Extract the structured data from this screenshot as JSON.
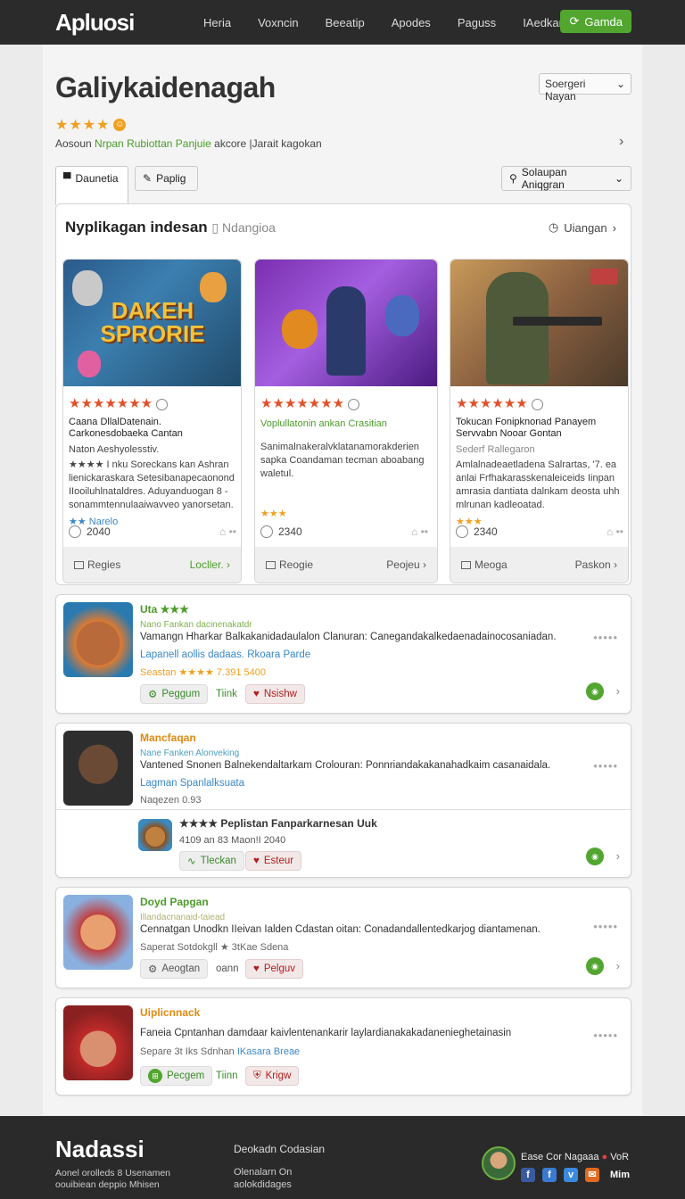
{
  "header": {
    "logo": "Apluosi",
    "nav": [
      "Heria",
      "Voxncin",
      "Beeatip",
      "Apodes",
      "Paguss",
      "IAedkamols"
    ],
    "cta": "Gamda"
  },
  "page": {
    "title": "Galiykaidenagah",
    "sort_label": "Soergeri Nayan",
    "rating_stars": "★★★★",
    "subtitle_prefix": "Aosoun",
    "subtitle_highlight": "Nrpan Rubiottan Panjuie",
    "subtitle_suffix": "akcore |Jarait kagokan",
    "tabs": [
      {
        "label": "Daunetia",
        "icon": "folder-icon"
      },
      {
        "label": "Paplig",
        "icon": "pencil-icon"
      }
    ],
    "filter_label": "Solaupan Aniqgran"
  },
  "featured": {
    "heading": "Nyplikagan indesan",
    "heading_muted": "Ndangioa",
    "action": "Uiangan",
    "cards": [
      {
        "banner_text": "DAKEH SPRORIE",
        "rating": "★★★★★★★",
        "title": "Caana DllalDatenain. Carkonesdobaeka Cantan",
        "subtitle": "Naton Aeshyolesstiv.",
        "description": "★★★★ I nku Soreckans kan Ashran lienickaraskara Setesibanapecaonond IIooiluhlnataldres. Aduyanduogan 8 - sonammtennulaaiwavveo yanorsetan.",
        "link": "★★ Narelo",
        "count": "2040",
        "footer_left": "Regies",
        "footer_right": "Locller."
      },
      {
        "banner_text": "",
        "rating": "★★★★★★★",
        "title": "Voplullatonin ankan Crasitian",
        "subtitle": "",
        "description": "Sanimalnakeralvklatanamorakderien sapka Coandaman tecman aboabang waletul.",
        "link": "★★★",
        "count": "2340",
        "footer_left": "Reogie",
        "footer_right": "Peojeu"
      },
      {
        "banner_text": "",
        "rating": "★★★★★★",
        "title": "Tokucan Fonipknonad Panayem Servvabn Nooar Gontan",
        "subtitle": "Sederf Rallegaron",
        "description": "Amlalnadeaetladena Salrartas, '7. ea anlai Frfhakarasskenaleiceids Iinpan amrasia dantiata dalnkam deosta uhh mlrunan kadleoatad.",
        "link": "★★★",
        "count": "2340",
        "footer_left": "Meoga",
        "footer_right": "Paskon"
      }
    ]
  },
  "list": [
    {
      "name": "Uta ★★★",
      "sub": "Nano Fankan dacinenakatdr",
      "description": "Vamangn Hharkar Balkakanidadaulalon Clanuran: Canegandakalkedaenadainocosaniadan.",
      "link": "Lapanell aollis dadaas. Rkoara Parde",
      "meta": "Seastan ★★★★ 7.391 5400",
      "pills": [
        "Peggum",
        "Tiink",
        "Nsishw"
      ]
    },
    {
      "name": "Mancfaqan",
      "sub": "Nane Fanken Alonveking",
      "description": "Vantened Snonen Balnekendaltarkam Crolouran: Ponnriandakakanahadkaim casanaidala.",
      "link": "Lagman Spanlalksuata",
      "meta": "Naqezen 0.93",
      "nested": {
        "title": "★★★★ Peplistan Fanparkarnesan Uuk",
        "meta": "4109 an 83 Maon!I 2040",
        "pills": [
          "Tleckan",
          "Esteur"
        ]
      }
    },
    {
      "name": "Doyd Papgan",
      "sub": "Illandacnanaid-taiead",
      "description": "Cennatgan Unodkn IIeivan Ialden Cdastan oitan: Conadandallentedkarjog diantamenan.",
      "link": "",
      "meta": "Saperat Sotdokgll ★ 3tKae Sdena",
      "pills": [
        "Aeogtan",
        "oann",
        "Pelguv"
      ]
    },
    {
      "name": "Uiplicnnack",
      "sub": "",
      "description": "Faneia Cpntanhan damdaar kaivlentenankarir laylardianakakadanenieghetainasin",
      "link": "IKasara Breae",
      "meta": "Separe 3t Iks Sdnhan",
      "pills": [
        "Pecgem",
        "Tiinn",
        "Krigw"
      ]
    }
  ],
  "footer": {
    "brand": "Nadassi",
    "tagline": "Aonel orolleds 8 Usenamen oouibiean deppio Mhisen",
    "column_title": "Deokadn Codasian",
    "links": [
      "Olenalarn On",
      "aolokdidages"
    ],
    "user": "Ease Cor Nagaaa",
    "user_tag": "VoR",
    "mim": "Mim"
  },
  "colors": {
    "header_bg": "#2b2b2b",
    "accent_green": "#52a630",
    "star": "#f0a020",
    "rating_red": "#e0502a",
    "link_blue": "#3a88c8"
  }
}
